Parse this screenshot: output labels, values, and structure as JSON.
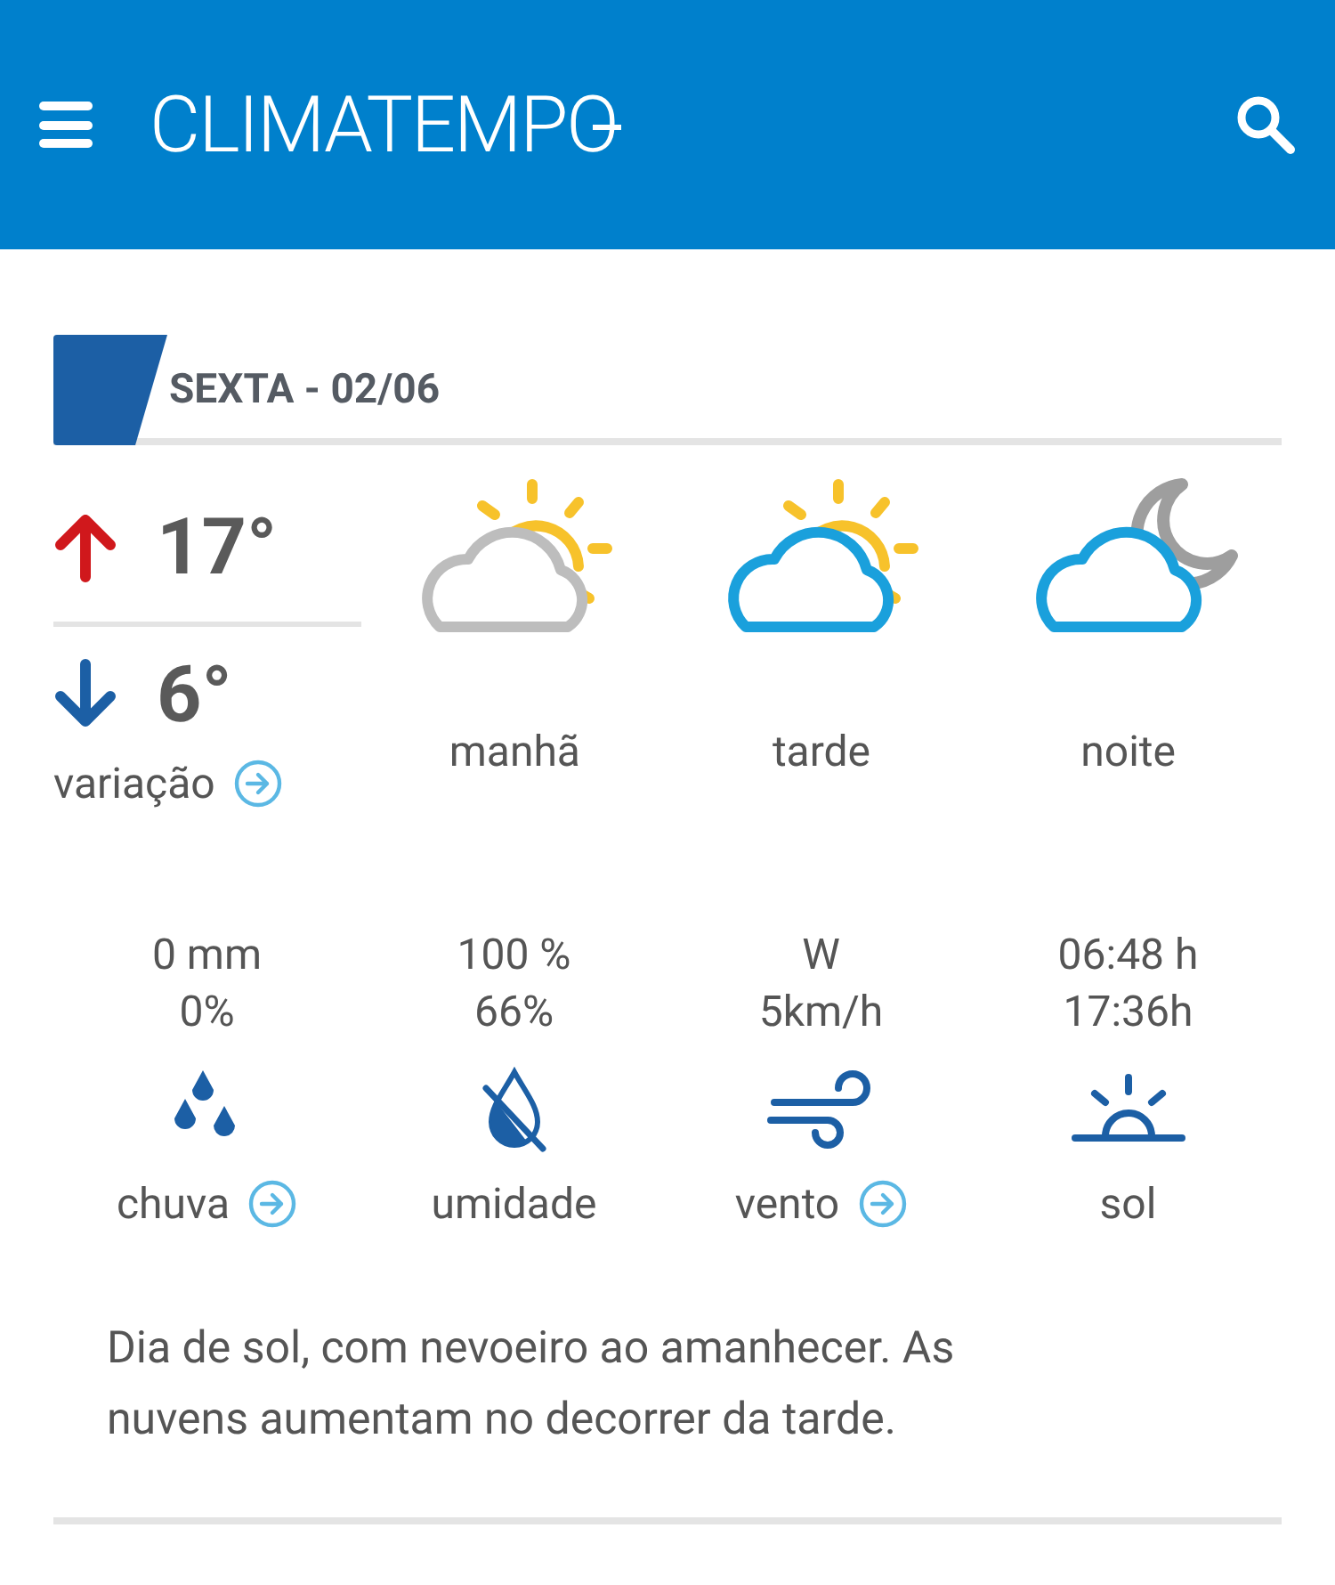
{
  "header": {
    "logo": "CLIMATEMPO"
  },
  "day": {
    "title": "SEXTA - 02/06"
  },
  "temps": {
    "max": "17°",
    "min": "6°",
    "variation": "variação",
    "variation_link": true
  },
  "periods": [
    {
      "label": "manhã",
      "kind": "sun",
      "overcast": true
    },
    {
      "label": "tarde",
      "kind": "sun",
      "overcast": false
    },
    {
      "label": "noite",
      "kind": "moon",
      "overcast": false
    }
  ],
  "stats": [
    {
      "kind": "rain",
      "lines": [
        "0 mm",
        "0%"
      ],
      "label": "chuva",
      "link": true
    },
    {
      "kind": "humidity",
      "lines": [
        "100 %",
        "66%"
      ],
      "label": "umidade",
      "link": false
    },
    {
      "kind": "wind",
      "lines": [
        "W",
        "5km/h"
      ],
      "label": "vento",
      "link": true
    },
    {
      "kind": "sun",
      "lines": [
        "06:48 h",
        "17:36h"
      ],
      "label": "sol",
      "link": false
    }
  ],
  "summary": "Dia de sol, com nevoeiro ao amanhecer. As nuvens aumentam no decorrer da tarde."
}
